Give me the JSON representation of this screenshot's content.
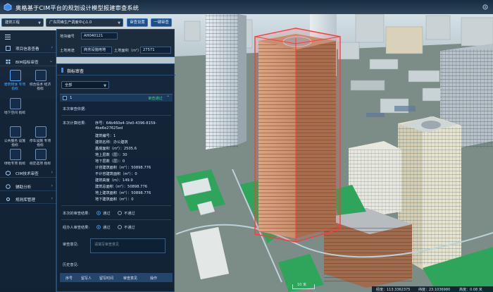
{
  "app": {
    "title": "奥格基于CIM平台的规划设计模型报建审查系统"
  },
  "toolbar": {
    "type_select": "建筑工程",
    "project_select": "广东同峰生产调度中心1.0",
    "audit_settings_label": "审查设置",
    "one_click_label": "一键审查"
  },
  "info": {
    "code_label": "地块编号",
    "code_value": "AH040121",
    "use_label": "土地用途",
    "use_value": "商务设施用地",
    "area_label": "土地面积（m²）",
    "area_value": "27571"
  },
  "sidebar": {
    "project_info": "项目信息查看",
    "bim_review": "BIM指标审查",
    "tiles": [
      {
        "label": "建筑物体 专项指标",
        "icon": "building-icon"
      },
      {
        "label": "综合技术 经济指标",
        "icon": "chart-icon"
      },
      {
        "label": "地下空间 指标",
        "icon": "layers-icon"
      },
      {
        "label": "公共服务 设施指标",
        "icon": "people-icon"
      },
      {
        "label": "停车设施 专项指标",
        "icon": "car-icon"
      },
      {
        "label": "绿地率 指标",
        "icon": "tree-icon"
      },
      {
        "label": "绿地专项 指标",
        "icon": "leaf-icon"
      },
      {
        "label": "规定选项 指标",
        "icon": "doc-icon"
      }
    ],
    "cim_review": "CIM技术审查",
    "assist": "辅助分析",
    "planning": "规则库管理"
  },
  "panel": {
    "title": "指标审查",
    "filter_value": "全部",
    "record_no": "1",
    "record_status": "审查通过",
    "audit_basis_label": "本次审查依据:",
    "calc_result_label": "本次计算结果:",
    "results": [
      "序号：64b460e4-1fe0-4396-8159-",
      "4be6e27625ed",
      "建筑编号：1",
      "建筑名称：办公建筑",
      "基底面积（m²）：2505.6",
      "地上层数（层）：30",
      "地下层数（层）：0",
      "计容建筑面积（m²）：50898.776",
      "不计容建筑面积（m²）：0",
      "建筑高度（m）：149.9",
      "建筑总面积（m²）：50898.776",
      "地上建筑面积（m²）：50898.776",
      "地下建筑面积（m²）：0"
    ],
    "review_result_label": "本次的审查结果:",
    "manual_review_label": "经办人审查结果:",
    "pass": "通过",
    "fail": "不通过",
    "opinion_label": "审查意见:",
    "opinion_placeholder": "请填写审查意见",
    "history_label": "历史意见:",
    "history_columns": [
      "序号",
      "留写人",
      "留写时间",
      "审查意见",
      "操作"
    ]
  },
  "map": {
    "scale_label": "10 米",
    "coords": [
      "经度：113.3362375",
      "纬度：23.1036980",
      "高度：0.08 米"
    ]
  },
  "colors": {
    "accent": "#3b8bea",
    "pass": "#3fd17a",
    "highlight": "#ff3b3b"
  }
}
